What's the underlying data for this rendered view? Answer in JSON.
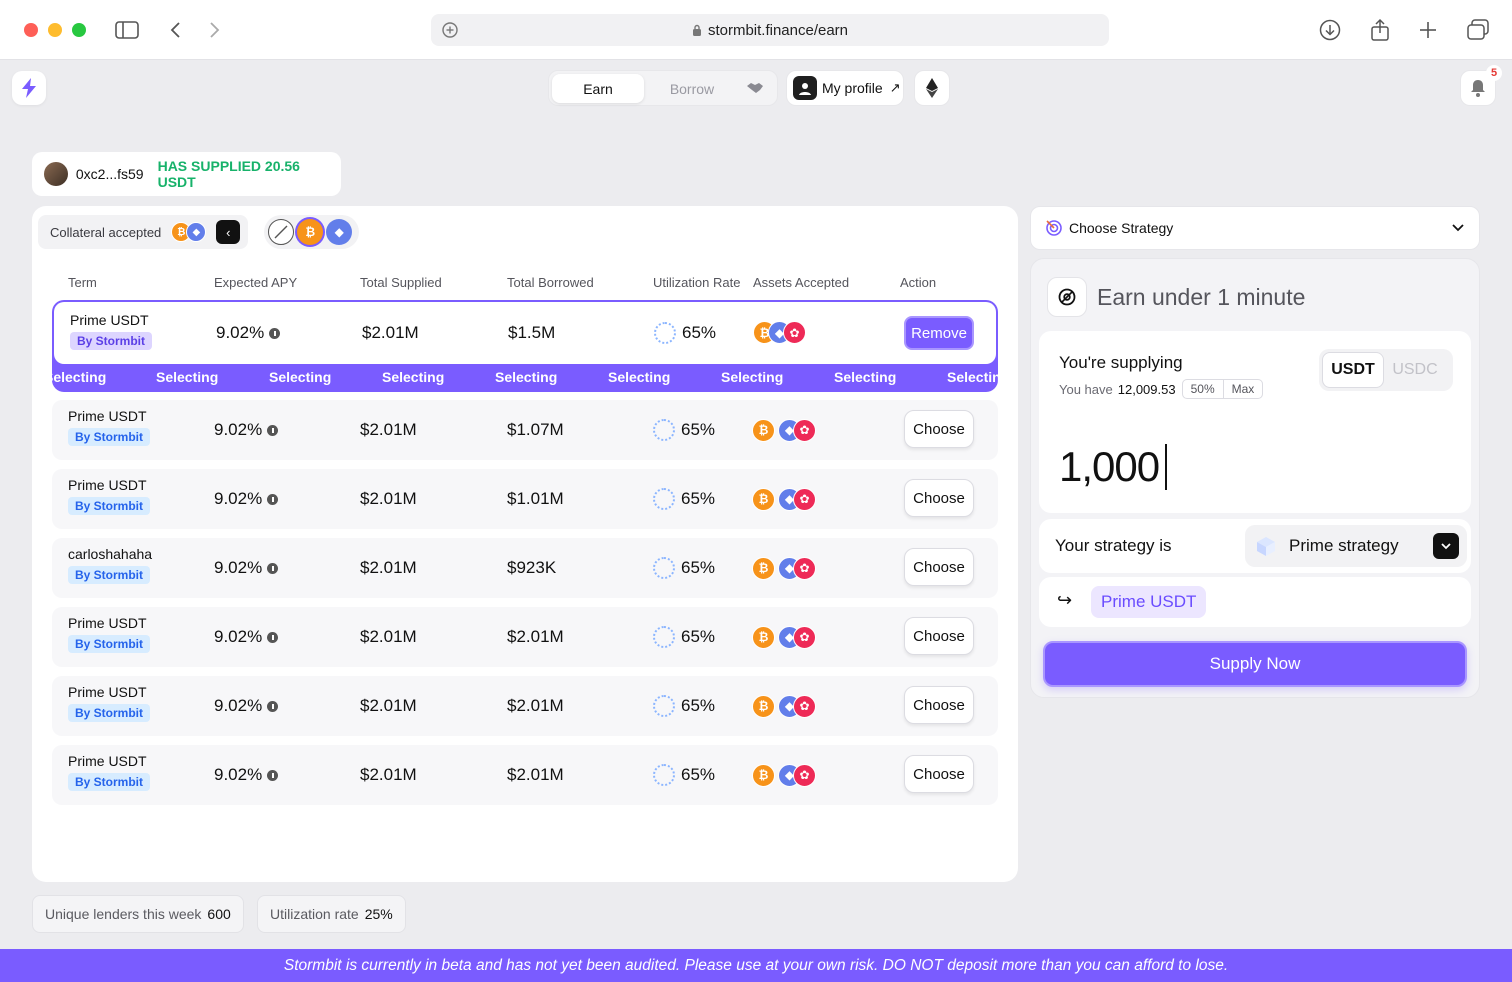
{
  "browser": {
    "url": "stormbit.finance/earn"
  },
  "nav": {
    "earn_label": "Earn",
    "borrow_label": "Borrow",
    "profile_label": "My profile",
    "notification_count": "5"
  },
  "supplied": {
    "address": "0xc2...fs59",
    "status": "HAS SUPPLIED 20.56 USDT"
  },
  "filters": {
    "collateral_label": "Collateral accepted"
  },
  "table": {
    "headers": {
      "term": "Term",
      "apy": "Expected APY",
      "supplied": "Total Supplied",
      "borrowed": "Total Borrowed",
      "util": "Utilization Rate",
      "assets": "Assets Accepted",
      "action": "Action"
    },
    "selected": {
      "name": "Prime USDT",
      "by": "By Stormbit",
      "apy": "9.02%",
      "supplied": "$2.01M",
      "borrowed": "$1.5M",
      "util": "65%",
      "action": "Remove",
      "marquee": "Selecting"
    },
    "rows": [
      {
        "name": "Prime USDT",
        "by": "By Stormbit",
        "apy": "9.02%",
        "supplied": "$2.01M",
        "borrowed": "$1.07M",
        "util": "65%",
        "action": "Choose"
      },
      {
        "name": "Prime USDT",
        "by": "By Stormbit",
        "apy": "9.02%",
        "supplied": "$2.01M",
        "borrowed": "$1.01M",
        "util": "65%",
        "action": "Choose"
      },
      {
        "name": "carloshahaha",
        "by": "By Stormbit",
        "apy": "9.02%",
        "supplied": "$2.01M",
        "borrowed": "$923K",
        "util": "65%",
        "action": "Choose"
      },
      {
        "name": "Prime USDT",
        "by": "By Stormbit",
        "apy": "9.02%",
        "supplied": "$2.01M",
        "borrowed": "$2.01M",
        "util": "65%",
        "action": "Choose"
      },
      {
        "name": "Prime USDT",
        "by": "By Stormbit",
        "apy": "9.02%",
        "supplied": "$2.01M",
        "borrowed": "$2.01M",
        "util": "65%",
        "action": "Choose"
      },
      {
        "name": "Prime USDT",
        "by": "By Stormbit",
        "apy": "9.02%",
        "supplied": "$2.01M",
        "borrowed": "$2.01M",
        "util": "65%",
        "action": "Choose"
      }
    ]
  },
  "stats": {
    "lenders_label": "Unique lenders this week",
    "lenders_value": "600",
    "util_label": "Utilization rate",
    "util_value": "25%"
  },
  "panel": {
    "choose_strategy": "Choose Strategy",
    "title": "Earn under 1 minute",
    "supplying_label": "You're supplying",
    "have_label": "You have",
    "balance": "12,009.53",
    "pct_50": "50%",
    "pct_max": "Max",
    "token_active": "USDT",
    "token_inactive": "USDC",
    "amount": "1,000",
    "strategy_label": "Your strategy is",
    "strategy_value": "Prime strategy",
    "prime_chip": "Prime USDT",
    "supply_button": "Supply Now"
  },
  "disclaimer": "Stormbit is currently in beta and has not yet been audited. Please use at your own risk. DO NOT deposit more than you can afford to lose.",
  "colors": {
    "accent": "#7a5cff",
    "success": "#17b26a",
    "badge_blue": "#2563eb"
  }
}
